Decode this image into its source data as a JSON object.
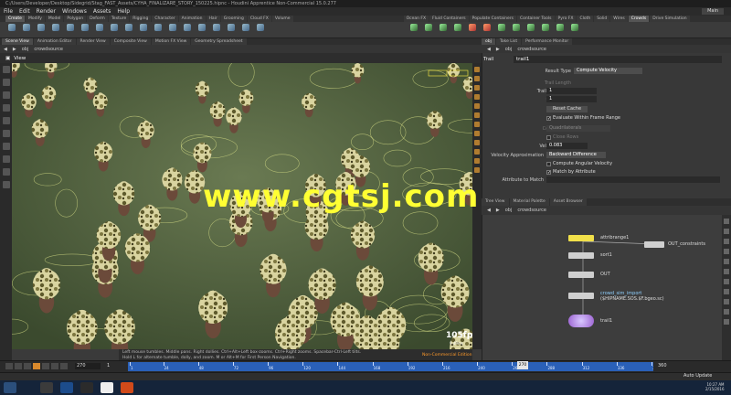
{
  "window": {
    "title": "C:/Users/Developer/Desktop/Sidegrid/Stag_FAST_Assets/CYHA_FINALIZARE_STORY_150225.hipnc - Houdini Apprentice Non-Commercial 15.0.277"
  },
  "menu": [
    "File",
    "Edit",
    "Render",
    "Windows",
    "Assets",
    "Help"
  ],
  "menu_workspace": "Main",
  "shelf_tabs_left": [
    "Create",
    "Modify",
    "Model",
    "Polygon",
    "Deform",
    "Texture",
    "Rigging",
    "Character",
    "Animation",
    "Hair",
    "Grooming",
    "Cloud FX",
    "Volume"
  ],
  "shelf_tabs_right": [
    "Ocean FX",
    "Fluid Containers",
    "Populate Containers",
    "Container Tools",
    "Pyro FX",
    "Cloth",
    "Solid",
    "Wires",
    "Crowds",
    "Drive Simulation"
  ],
  "viewer_tabs": [
    "Scene View",
    "Animation Editor",
    "Render View",
    "Composite View",
    "Motion FX View",
    "Geometry Spreadsheet"
  ],
  "viewer_path": [
    "obj",
    "crowdsource"
  ],
  "viewer_label": "View",
  "viewer": {
    "fps": "105fps",
    "fps_ms": "9.49ms",
    "noncommercial": "Non-Commercial Edition",
    "status_line1": "Left mouse tumbles. Middle pans. Right dollies. Ctrl+Alt+Left box-zooms. Ctrl+Right zooms. Spacebar-Ctrl-Left tilts.",
    "status_line2": "Hold L for alternate tumble, dolly, and zoom. M or Alt+M for First Person Navigation."
  },
  "param_tabs": [
    "obj",
    "Take List",
    "Performance Monitor"
  ],
  "param_path": [
    "obj",
    "crowdsource"
  ],
  "params": {
    "node_type": "Trail",
    "node_name": "trail1",
    "result_type_label": "Result Type",
    "result_type": "Compute Velocity",
    "trail_length_label": "Trail Length",
    "trail_increment_label": "Trail Increment",
    "trail_increment": "1",
    "cache_size_label": "Cache Size",
    "cache_size": "1",
    "reset_cache": "Reset Cache",
    "eval_frame_range": "Evaluate Within Frame Range",
    "connectivity_label": "Connectivity",
    "connectivity": "Quadrilaterals",
    "close_rows": "Close Rows",
    "velocity_scale_label": "Velocity Scale",
    "velocity_scale": "0.083",
    "velocity_approx_label": "Velocity Approximation",
    "velocity_approx": "Backward Difference",
    "angular_velocity": "Compute Angular Velocity",
    "match_attr": "Match by Attribute",
    "attr_match_label": "Attribute to Match"
  },
  "net_tabs": [
    "Tree View",
    "Material Palette",
    "Asset Browser"
  ],
  "net_path": [
    "obj",
    "crowdsource"
  ],
  "nodes": [
    "attribrange1",
    "OUT_constraints",
    "sort1",
    "OUT",
    "crowd_sim_import",
    "($HIPNAME.SOS.$F.bgeo.sc)",
    "trail1"
  ],
  "timeline": {
    "frame": "270",
    "start": "1",
    "ticks": [
      "1",
      "24",
      "48",
      "72",
      "96",
      "120",
      "144",
      "168",
      "192",
      "216",
      "240",
      "264",
      "288",
      "312",
      "336",
      "360"
    ],
    "current": "270",
    "end": "360",
    "auto_update": "Auto Update"
  },
  "tray": {
    "time": "10:27 AM",
    "date": "2/15/2016"
  },
  "watermark": "www.cgtsj.com",
  "colors": {
    "accent": "#d9892c",
    "timeline": "#2a60b8",
    "watermark": "#ffff33"
  }
}
